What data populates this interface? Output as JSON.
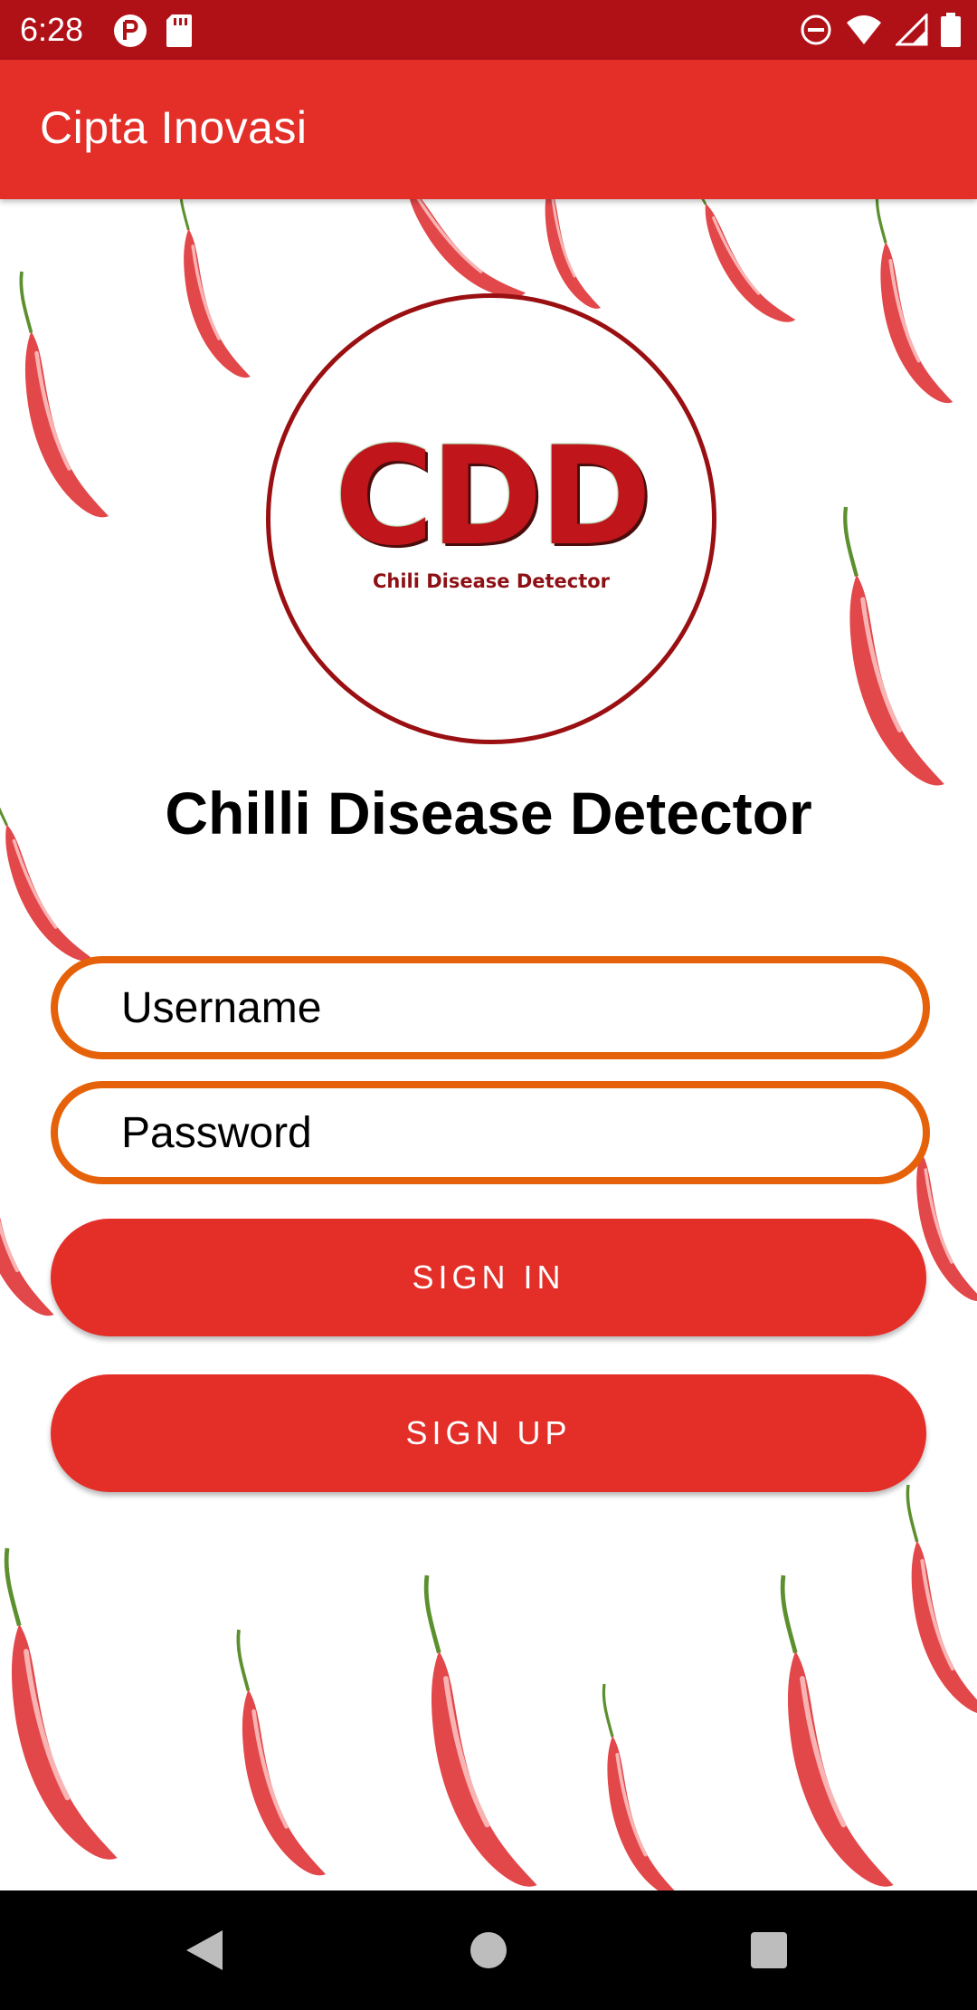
{
  "status_bar": {
    "time": "6:28",
    "left_icons": [
      "pocket-icon",
      "sd-card-icon"
    ],
    "right_icons": [
      "do-not-disturb-icon",
      "wifi-icon",
      "signal-icon",
      "battery-icon"
    ],
    "background_color": "#b01117"
  },
  "app_bar": {
    "title": "Cipta Inovasi",
    "background_color": "#e42e28"
  },
  "logo": {
    "text": "CDD",
    "subtitle": "Chili Disease Detector",
    "border_color": "#9a1012"
  },
  "page": {
    "heading": "Chilli Disease Detector"
  },
  "form": {
    "username_placeholder": "Username",
    "password_placeholder": "Password",
    "field_border_color": "#e5620a"
  },
  "buttons": {
    "sign_in_label": "SIGN IN",
    "sign_up_label": "SIGN UP",
    "color": "#e42e28"
  },
  "background": {
    "pattern": "red-chili-pepper",
    "pepper_color": "#e84545"
  },
  "nav_bar": {
    "items": [
      "back-icon",
      "home-icon",
      "recents-icon"
    ]
  }
}
